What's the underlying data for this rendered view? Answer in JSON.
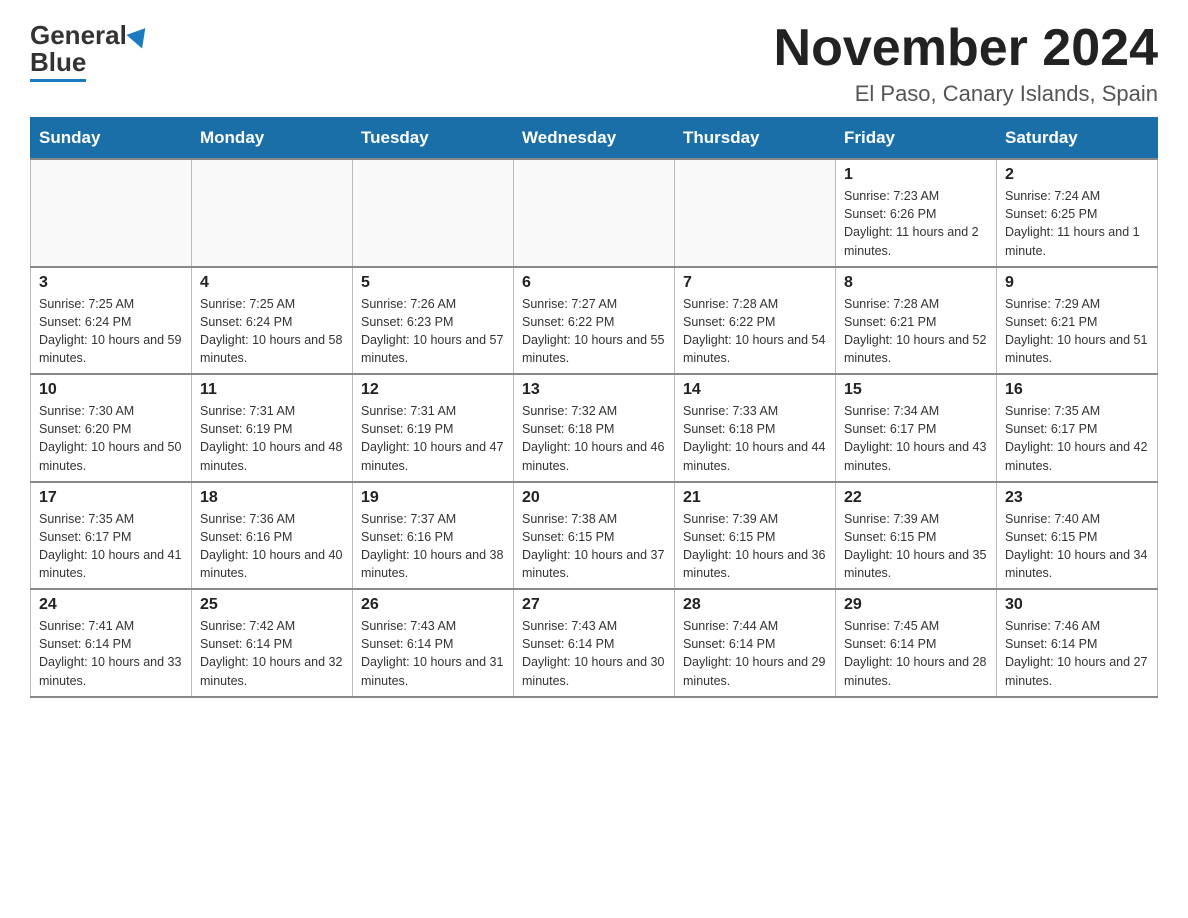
{
  "header": {
    "logo_general": "General",
    "logo_blue": "Blue",
    "page_title": "November 2024",
    "subtitle": "El Paso, Canary Islands, Spain"
  },
  "weekdays": [
    "Sunday",
    "Monday",
    "Tuesday",
    "Wednesday",
    "Thursday",
    "Friday",
    "Saturday"
  ],
  "weeks": [
    [
      {
        "day": "",
        "info": ""
      },
      {
        "day": "",
        "info": ""
      },
      {
        "day": "",
        "info": ""
      },
      {
        "day": "",
        "info": ""
      },
      {
        "day": "",
        "info": ""
      },
      {
        "day": "1",
        "info": "Sunrise: 7:23 AM\nSunset: 6:26 PM\nDaylight: 11 hours and 2 minutes."
      },
      {
        "day": "2",
        "info": "Sunrise: 7:24 AM\nSunset: 6:25 PM\nDaylight: 11 hours and 1 minute."
      }
    ],
    [
      {
        "day": "3",
        "info": "Sunrise: 7:25 AM\nSunset: 6:24 PM\nDaylight: 10 hours and 59 minutes."
      },
      {
        "day": "4",
        "info": "Sunrise: 7:25 AM\nSunset: 6:24 PM\nDaylight: 10 hours and 58 minutes."
      },
      {
        "day": "5",
        "info": "Sunrise: 7:26 AM\nSunset: 6:23 PM\nDaylight: 10 hours and 57 minutes."
      },
      {
        "day": "6",
        "info": "Sunrise: 7:27 AM\nSunset: 6:22 PM\nDaylight: 10 hours and 55 minutes."
      },
      {
        "day": "7",
        "info": "Sunrise: 7:28 AM\nSunset: 6:22 PM\nDaylight: 10 hours and 54 minutes."
      },
      {
        "day": "8",
        "info": "Sunrise: 7:28 AM\nSunset: 6:21 PM\nDaylight: 10 hours and 52 minutes."
      },
      {
        "day": "9",
        "info": "Sunrise: 7:29 AM\nSunset: 6:21 PM\nDaylight: 10 hours and 51 minutes."
      }
    ],
    [
      {
        "day": "10",
        "info": "Sunrise: 7:30 AM\nSunset: 6:20 PM\nDaylight: 10 hours and 50 minutes."
      },
      {
        "day": "11",
        "info": "Sunrise: 7:31 AM\nSunset: 6:19 PM\nDaylight: 10 hours and 48 minutes."
      },
      {
        "day": "12",
        "info": "Sunrise: 7:31 AM\nSunset: 6:19 PM\nDaylight: 10 hours and 47 minutes."
      },
      {
        "day": "13",
        "info": "Sunrise: 7:32 AM\nSunset: 6:18 PM\nDaylight: 10 hours and 46 minutes."
      },
      {
        "day": "14",
        "info": "Sunrise: 7:33 AM\nSunset: 6:18 PM\nDaylight: 10 hours and 44 minutes."
      },
      {
        "day": "15",
        "info": "Sunrise: 7:34 AM\nSunset: 6:17 PM\nDaylight: 10 hours and 43 minutes."
      },
      {
        "day": "16",
        "info": "Sunrise: 7:35 AM\nSunset: 6:17 PM\nDaylight: 10 hours and 42 minutes."
      }
    ],
    [
      {
        "day": "17",
        "info": "Sunrise: 7:35 AM\nSunset: 6:17 PM\nDaylight: 10 hours and 41 minutes."
      },
      {
        "day": "18",
        "info": "Sunrise: 7:36 AM\nSunset: 6:16 PM\nDaylight: 10 hours and 40 minutes."
      },
      {
        "day": "19",
        "info": "Sunrise: 7:37 AM\nSunset: 6:16 PM\nDaylight: 10 hours and 38 minutes."
      },
      {
        "day": "20",
        "info": "Sunrise: 7:38 AM\nSunset: 6:15 PM\nDaylight: 10 hours and 37 minutes."
      },
      {
        "day": "21",
        "info": "Sunrise: 7:39 AM\nSunset: 6:15 PM\nDaylight: 10 hours and 36 minutes."
      },
      {
        "day": "22",
        "info": "Sunrise: 7:39 AM\nSunset: 6:15 PM\nDaylight: 10 hours and 35 minutes."
      },
      {
        "day": "23",
        "info": "Sunrise: 7:40 AM\nSunset: 6:15 PM\nDaylight: 10 hours and 34 minutes."
      }
    ],
    [
      {
        "day": "24",
        "info": "Sunrise: 7:41 AM\nSunset: 6:14 PM\nDaylight: 10 hours and 33 minutes."
      },
      {
        "day": "25",
        "info": "Sunrise: 7:42 AM\nSunset: 6:14 PM\nDaylight: 10 hours and 32 minutes."
      },
      {
        "day": "26",
        "info": "Sunrise: 7:43 AM\nSunset: 6:14 PM\nDaylight: 10 hours and 31 minutes."
      },
      {
        "day": "27",
        "info": "Sunrise: 7:43 AM\nSunset: 6:14 PM\nDaylight: 10 hours and 30 minutes."
      },
      {
        "day": "28",
        "info": "Sunrise: 7:44 AM\nSunset: 6:14 PM\nDaylight: 10 hours and 29 minutes."
      },
      {
        "day": "29",
        "info": "Sunrise: 7:45 AM\nSunset: 6:14 PM\nDaylight: 10 hours and 28 minutes."
      },
      {
        "day": "30",
        "info": "Sunrise: 7:46 AM\nSunset: 6:14 PM\nDaylight: 10 hours and 27 minutes."
      }
    ]
  ]
}
